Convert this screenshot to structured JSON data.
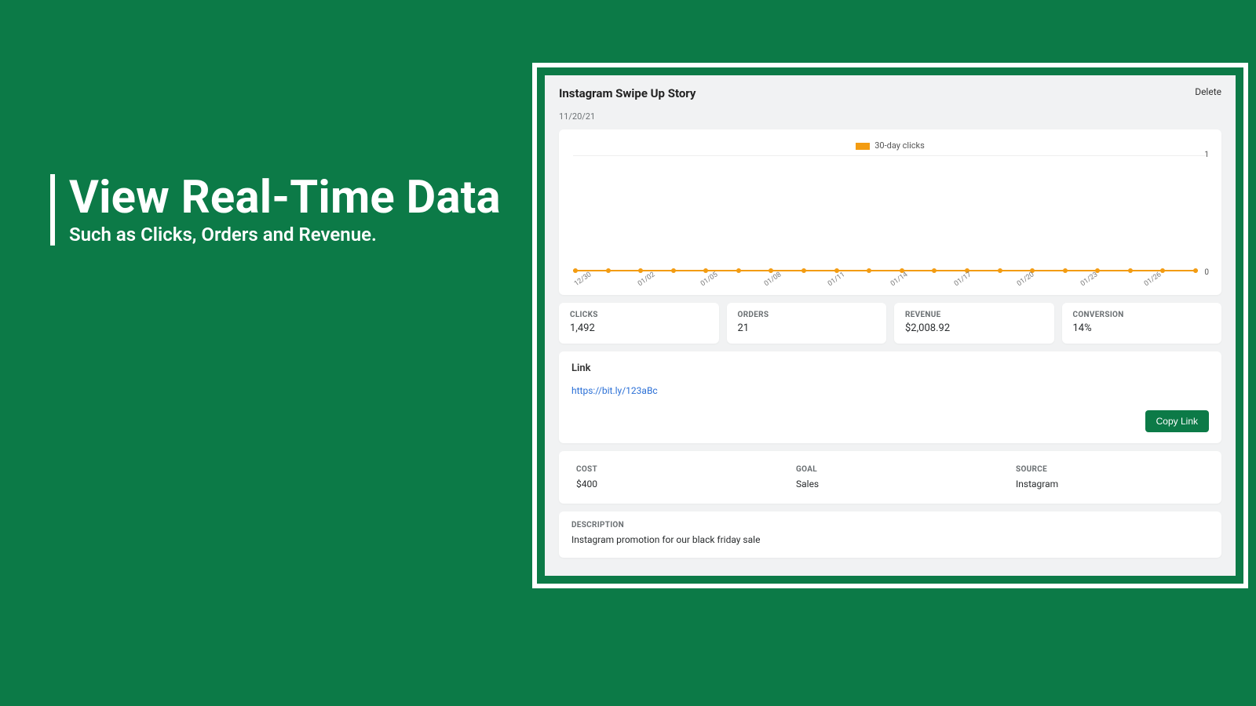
{
  "marketing": {
    "title": "View Real-Time Data",
    "subtitle": "Such as Clicks, Orders and Revenue."
  },
  "page": {
    "title": "Instagram Swipe Up Story",
    "delete_label": "Delete",
    "date": "11/20/21"
  },
  "chart_data": {
    "type": "line",
    "title": "",
    "legend": "30-day clicks",
    "ylabel": "",
    "xlabel": "",
    "ylim": [
      0,
      1
    ],
    "yticks": [
      "1",
      "0"
    ],
    "categories": [
      "12/30",
      "",
      "01/02",
      "",
      "01/05",
      "",
      "01/08",
      "",
      "01/11",
      "",
      "01/14",
      "",
      "01/17",
      "",
      "01/20",
      "",
      "01/23",
      "",
      "01/26",
      ""
    ],
    "series": [
      {
        "name": "30-day clicks",
        "values": [
          0,
          0,
          0,
          0,
          0,
          0,
          0,
          0,
          0,
          0,
          0,
          0,
          0,
          0,
          0,
          0,
          0,
          0,
          0,
          0
        ]
      }
    ]
  },
  "stats": [
    {
      "label": "CLICKS",
      "value": "1,492"
    },
    {
      "label": "ORDERS",
      "value": "21"
    },
    {
      "label": "REVENUE",
      "value": "$2,008.92"
    },
    {
      "label": "CONVERSION",
      "value": "14%"
    }
  ],
  "link": {
    "title": "Link",
    "url": "https://bit.ly/123aBc",
    "copy_label": "Copy Link"
  },
  "attributes": [
    {
      "label": "COST",
      "value": "$400"
    },
    {
      "label": "GOAL",
      "value": "Sales"
    },
    {
      "label": "SOURCE",
      "value": "Instagram"
    }
  ],
  "description": {
    "label": "DESCRIPTION",
    "text": "Instagram promotion for our black friday sale"
  }
}
